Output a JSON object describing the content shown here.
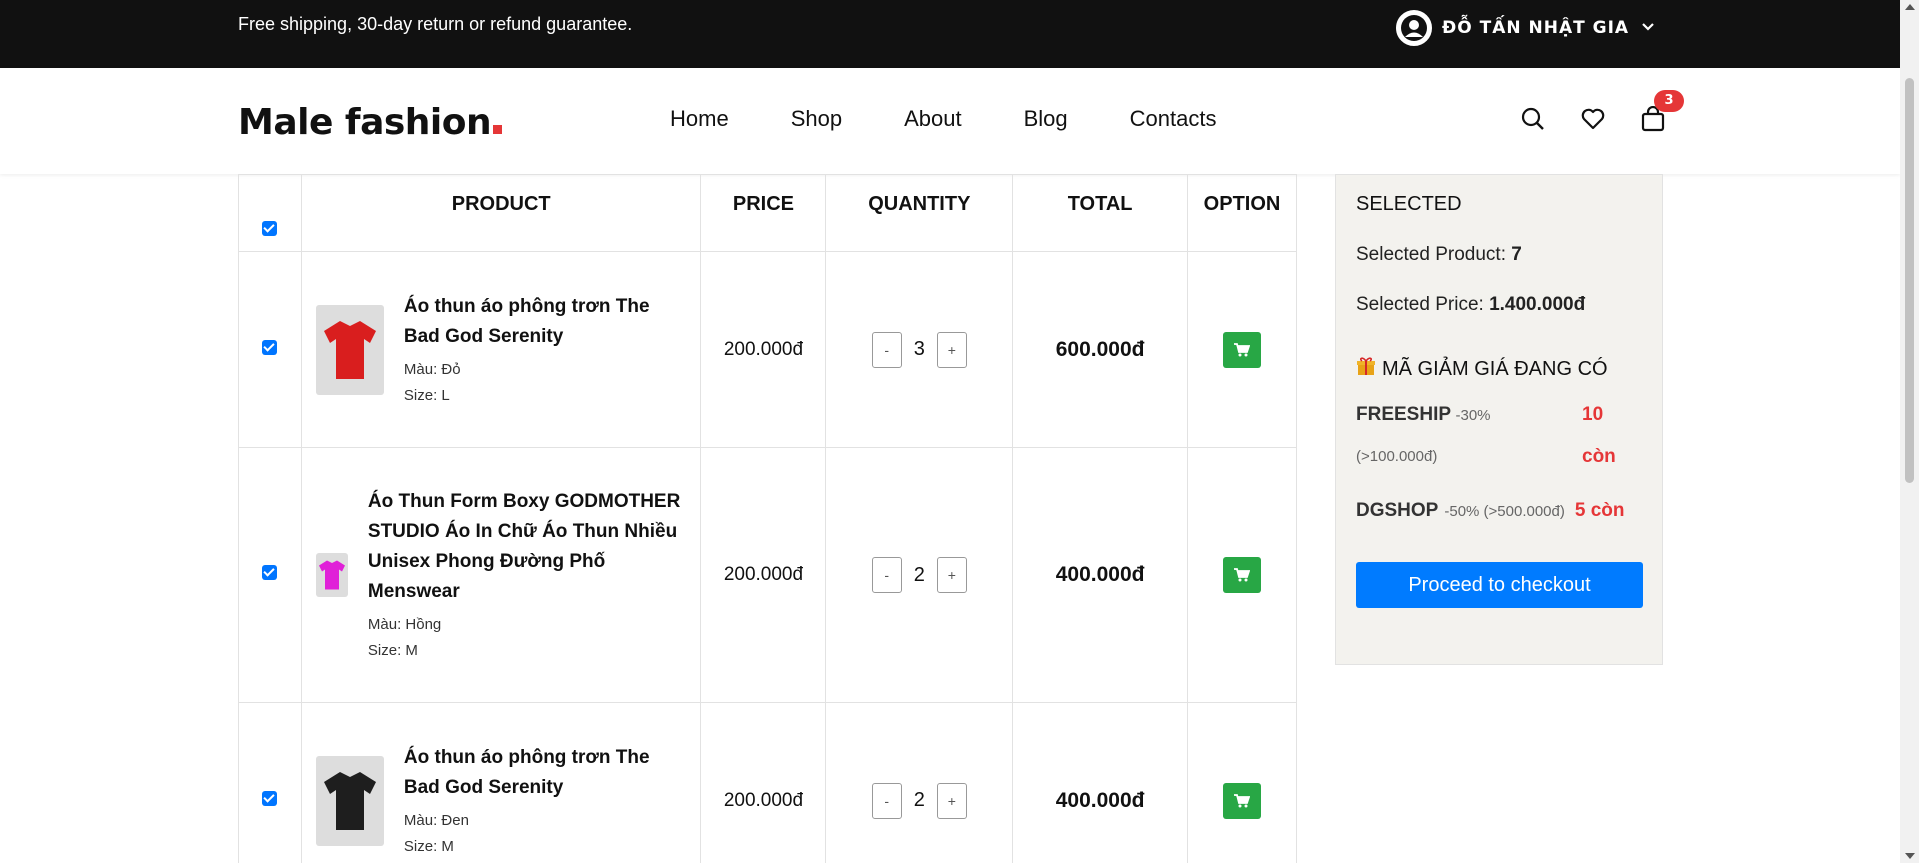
{
  "topbar": {
    "promo": "Free shipping, 30-day return or refund guarantee.",
    "user_name": "ĐỖ TẤN NHẬT GIA"
  },
  "header": {
    "logo_text": "Male fashion",
    "nav": [
      "Home",
      "Shop",
      "About",
      "Blog",
      "Contacts"
    ],
    "cart_count": "3"
  },
  "table": {
    "headers": [
      "PRODUCT",
      "PRICE",
      "QUANTITY",
      "TOTAL",
      "OPTION"
    ],
    "rows": [
      {
        "name": "Áo thun áo phông trơn The Bad God Serenity",
        "color": "Màu: Đỏ",
        "size": "Size: L",
        "price": "200.000đ",
        "qty": "3",
        "total": "600.000đ",
        "shirt_color": "#d91e1e"
      },
      {
        "name": "Áo Thun Form Boxy GODMOTHER STUDIO Áo In Chữ Áo Thun Nhiều Unisex Phong Đường Phố Menswear",
        "color": "Màu: Hồng",
        "size": "Size: M",
        "price": "200.000đ",
        "qty": "2",
        "total": "400.000đ",
        "shirt_color": "#e020d8"
      },
      {
        "name": "Áo thun áo phông trơn The Bad God Serenity",
        "color": "Màu: Đen",
        "size": "Size: M",
        "price": "200.000đ",
        "qty": "2",
        "total": "400.000đ",
        "shirt_color": "#1e1e1e"
      }
    ],
    "minus": "-",
    "plus": "+"
  },
  "sidebar": {
    "title": "SELECTED",
    "product_label": "Selected Product:",
    "product_value": "7",
    "price_label": "Selected Price:",
    "price_value": "1.400.000đ",
    "discount_title": "MÃ GIẢM GIÁ ĐANG CÓ",
    "coupons": [
      {
        "code": "FREESHIP",
        "pct": "-30%",
        "min": "(>100.000đ)",
        "remaining": "10",
        "unit": "còn"
      },
      {
        "code": "DGSHOP",
        "pct": "-50% (>500.000đ)",
        "remaining": "5 còn"
      }
    ],
    "checkout_label": "Proceed to checkout"
  },
  "colors": {
    "accent_red": "#e53637",
    "checkout_blue": "#007bff",
    "cart_green": "#28a745"
  }
}
